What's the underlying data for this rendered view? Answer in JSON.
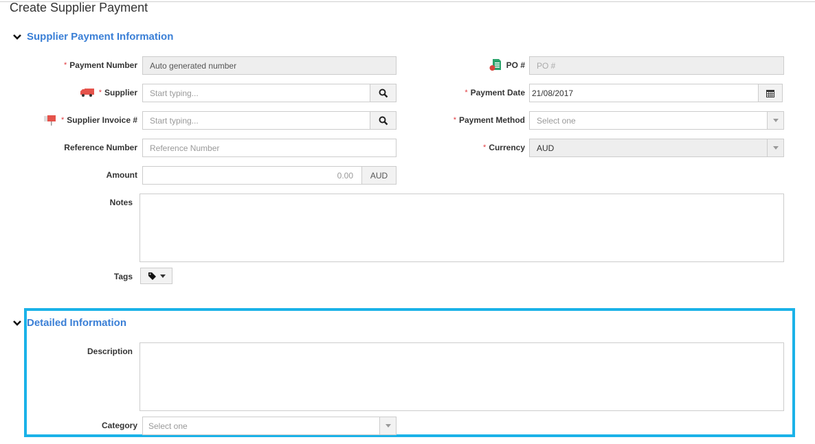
{
  "page": {
    "title": "Create Supplier Payment"
  },
  "sections": {
    "payment_info": {
      "title": "Supplier Payment Information"
    },
    "detailed_info": {
      "title": "Detailed Information"
    }
  },
  "fields": {
    "payment_number": {
      "label": "Payment Number",
      "required": true,
      "value": "Auto generated number"
    },
    "supplier": {
      "label": "Supplier",
      "required": true,
      "placeholder": "Start typing..."
    },
    "supplier_invoice": {
      "label": "Supplier Invoice #",
      "required": true,
      "placeholder": "Start typing..."
    },
    "reference_number": {
      "label": "Reference Number",
      "placeholder": "Reference Number"
    },
    "amount": {
      "label": "Amount",
      "placeholder": "0.00",
      "currency_addon": "AUD"
    },
    "notes": {
      "label": "Notes"
    },
    "tags": {
      "label": "Tags"
    },
    "po_number": {
      "label": "PO #",
      "placeholder": "PO #"
    },
    "payment_date": {
      "label": "Payment Date",
      "required": true,
      "value": "21/08/2017"
    },
    "payment_method": {
      "label": "Payment Method",
      "required": true,
      "selected": "Select one"
    },
    "currency": {
      "label": "Currency",
      "required": true,
      "selected": "AUD"
    },
    "description": {
      "label": "Description"
    },
    "category": {
      "label": "Category",
      "selected": "Select one"
    }
  },
  "required_marker": "*",
  "colors": {
    "accent": "#3a7fd6",
    "required": "#e0393e",
    "highlight": "#1ab2e8",
    "icon_red": "#e5534b",
    "icon_green": "#2aa36b"
  }
}
